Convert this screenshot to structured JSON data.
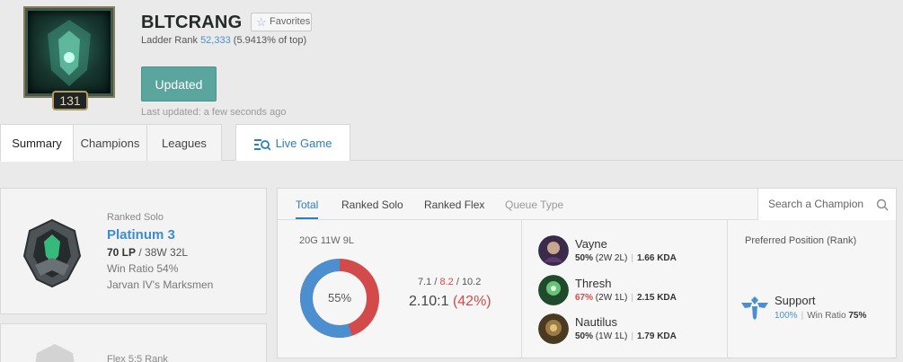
{
  "profile": {
    "name": "BLTCRANG",
    "level": "131",
    "favorites_label": "Favorites",
    "ladder_prefix": "Ladder Rank",
    "ladder_rank": "52,333",
    "ladder_suffix": "(5.9413% of top)",
    "update_label": "Updated",
    "last_updated": "Last updated: a few seconds ago"
  },
  "tabs": [
    {
      "label": "Summary"
    },
    {
      "label": "Champions"
    },
    {
      "label": "Leagues"
    },
    {
      "label": "Live Game"
    }
  ],
  "ranked_solo": {
    "label": "Ranked Solo",
    "tier": "Platinum 3",
    "lp": "70 LP",
    "record": " / 38W 32L",
    "win_ratio": "Win Ratio 54%",
    "league": "Jarvan IV's Marksmen"
  },
  "ranked_flex": {
    "label": "Flex 5:5 Rank"
  },
  "stats_tabs": [
    {
      "label": "Total"
    },
    {
      "label": "Ranked Solo"
    },
    {
      "label": "Ranked Flex"
    },
    {
      "label": "Queue Type"
    }
  ],
  "search": {
    "placeholder": "Search a Champion"
  },
  "summary": {
    "games": "20G 11W 9L",
    "winrate_label": "55%",
    "winrate": 0.55,
    "kills": "7.1",
    "deaths": "8.2",
    "assists": "10.2",
    "kda_ratio": "2.10:1",
    "kill_participation": "(42%)"
  },
  "champions": [
    {
      "name": "Vayne",
      "winrate": "50%",
      "record": "(2W 2L)",
      "kda": "1.66 KDA",
      "bad": false
    },
    {
      "name": "Thresh",
      "winrate": "67%",
      "record": "(2W 1L)",
      "kda": "2.15 KDA",
      "bad": true
    },
    {
      "name": "Nautilus",
      "winrate": "50%",
      "record": "(1W 1L)",
      "kda": "1.79 KDA",
      "bad": false
    }
  ],
  "position": {
    "title": "Preferred Position (Rank)",
    "role": "Support",
    "share": "100%",
    "winratio_label": "Win Ratio",
    "winratio": "75%"
  },
  "colors": {
    "accent": "#2c7fbf",
    "win": "#4b8fd0",
    "loss": "#d24a4a",
    "update_button": "#5aa59e"
  }
}
